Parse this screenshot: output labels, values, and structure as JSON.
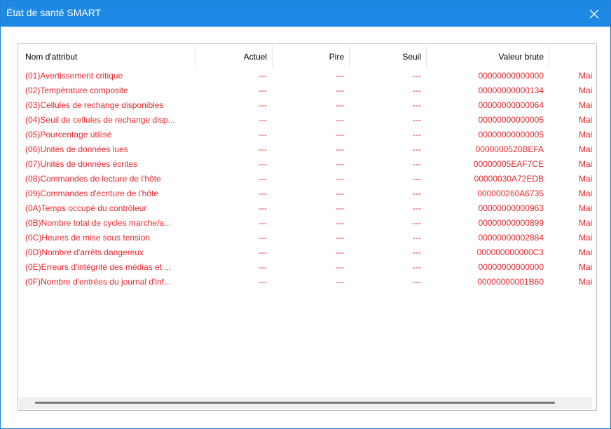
{
  "window": {
    "title": "État de santé SMART"
  },
  "table": {
    "columns": [
      "Nom d'attribut",
      "Actuel",
      "Pire",
      "Seuil",
      "Valeur brute"
    ],
    "rows": [
      {
        "name": "(01)Avertissement critique",
        "current": "---",
        "worst": "---",
        "threshold": "---",
        "raw": "00000000000000",
        "extra": "Mai"
      },
      {
        "name": "(02)Température composite",
        "current": "---",
        "worst": "---",
        "threshold": "---",
        "raw": "00000000000134",
        "extra": "Mai"
      },
      {
        "name": "(03)Cellules de rechange disponibles",
        "current": "---",
        "worst": "---",
        "threshold": "---",
        "raw": "00000000000064",
        "extra": "Mai"
      },
      {
        "name": "(04)Seuil de cellules de rechange disp...",
        "current": "---",
        "worst": "---",
        "threshold": "---",
        "raw": "00000000000005",
        "extra": "Mai"
      },
      {
        "name": "(05)Pourcentage utilisé",
        "current": "---",
        "worst": "---",
        "threshold": "---",
        "raw": "00000000000005",
        "extra": "Mai"
      },
      {
        "name": "(06)Unités de données lues",
        "current": "---",
        "worst": "---",
        "threshold": "---",
        "raw": "0000000520BEFA",
        "extra": "Mai"
      },
      {
        "name": "(07)Unités de données écrites",
        "current": "---",
        "worst": "---",
        "threshold": "---",
        "raw": "00000005EAF7CE",
        "extra": "Mai"
      },
      {
        "name": "(08)Commandes de lecture de l'hôte",
        "current": "---",
        "worst": "---",
        "threshold": "---",
        "raw": "00000030A72EDB",
        "extra": "Mai"
      },
      {
        "name": "(09)Commandes d'écriture de l'hôte",
        "current": "---",
        "worst": "---",
        "threshold": "---",
        "raw": "000000260A6735",
        "extra": "Mai"
      },
      {
        "name": "(0A)Temps occupé du contrôleur",
        "current": "---",
        "worst": "---",
        "threshold": "---",
        "raw": "00000000000963",
        "extra": "Mai"
      },
      {
        "name": "(0B)Nombre total de cycles marche/a...",
        "current": "---",
        "worst": "---",
        "threshold": "---",
        "raw": "00000000000899",
        "extra": "Mai"
      },
      {
        "name": "(0C)Heures de mise sous tension",
        "current": "---",
        "worst": "---",
        "threshold": "---",
        "raw": "00000000002884",
        "extra": "Mai"
      },
      {
        "name": "(0D)Nombre d'arrêts dangereux",
        "current": "---",
        "worst": "---",
        "threshold": "---",
        "raw": "000000000000C3",
        "extra": "Mai"
      },
      {
        "name": "(0E)Erreurs d'intégrité des médias et ...",
        "current": "---",
        "worst": "---",
        "threshold": "---",
        "raw": "00000000000000",
        "extra": "Mai"
      },
      {
        "name": "(0F)Nombre d'entrées du journal d'inf...",
        "current": "---",
        "worst": "---",
        "threshold": "---",
        "raw": "00000000001B60",
        "extra": "Mai"
      }
    ]
  },
  "colors": {
    "titlebar": "#1e88e5",
    "row_text": "#e8262b",
    "border": "#bfbfbf"
  },
  "icons": {
    "close": "close-icon"
  }
}
